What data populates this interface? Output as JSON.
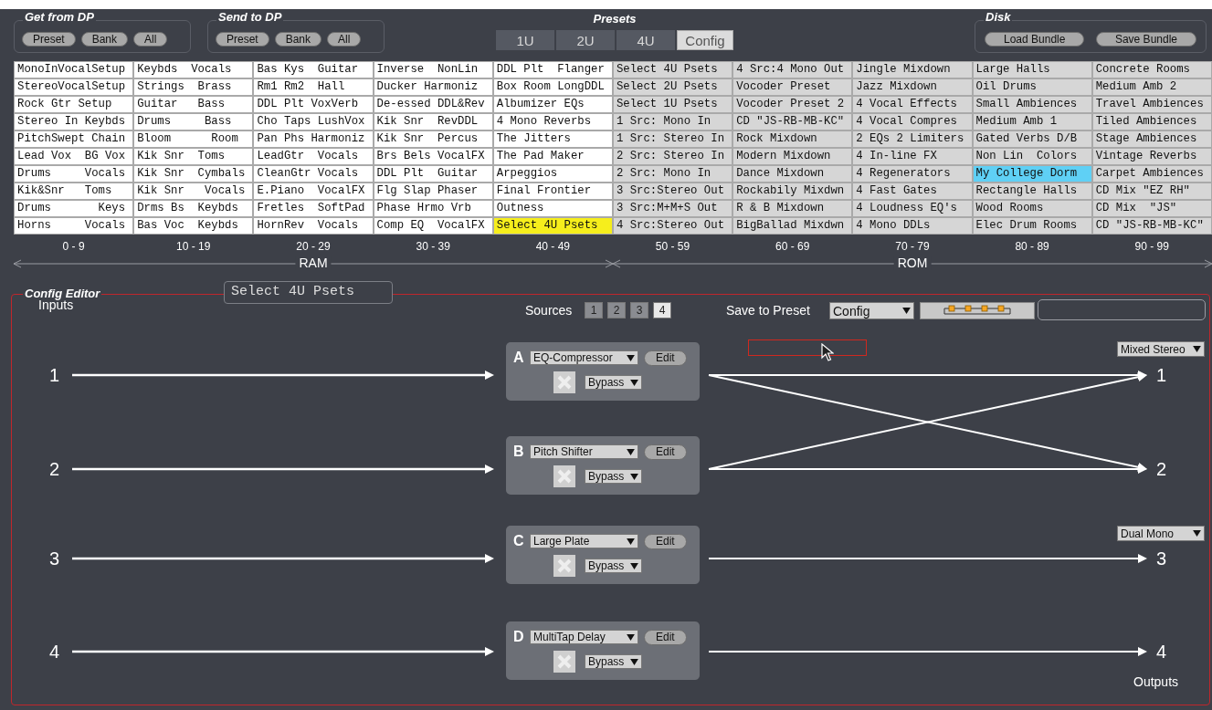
{
  "top_panel": {
    "get_from_dp": {
      "title": "Get from DP",
      "buttons": [
        "Preset",
        "Bank",
        "All"
      ]
    },
    "send_to_dp": {
      "title": "Send to DP",
      "buttons": [
        "Preset",
        "Bank",
        "All"
      ]
    },
    "presets": {
      "title": "Presets",
      "tabs": [
        {
          "label": "1U",
          "selected": false
        },
        {
          "label": "2U",
          "selected": false
        },
        {
          "label": "4U",
          "selected": false
        },
        {
          "label": "Config",
          "selected": true
        }
      ]
    },
    "disk": {
      "title": "Disk",
      "buttons": [
        "Load Bundle",
        "Save Bundle"
      ]
    }
  },
  "banks": [
    {
      "range": "0 - 9",
      "rom": false,
      "presets": [
        {
          "name": "MonoInVocalSetup",
          "selected": false,
          "drop_target": false
        },
        {
          "name": "StereoVocalSetup",
          "selected": false,
          "drop_target": false
        },
        {
          "name": "Rock Gtr Setup",
          "selected": false,
          "drop_target": false
        },
        {
          "name": "Stereo In Keybds",
          "selected": false,
          "drop_target": false
        },
        {
          "name": "PitchSwept Chain",
          "selected": false,
          "drop_target": false
        },
        {
          "name": "Lead Vox  BG Vox",
          "selected": false,
          "drop_target": false
        },
        {
          "name": "Drums     Vocals",
          "selected": false,
          "drop_target": false
        },
        {
          "name": "Kik&Snr   Toms",
          "selected": false,
          "drop_target": false
        },
        {
          "name": "Drums       Keys",
          "selected": false,
          "drop_target": false
        },
        {
          "name": "Horns     Vocals",
          "selected": false,
          "drop_target": false
        }
      ]
    },
    {
      "range": "10 - 19",
      "rom": false,
      "presets": [
        {
          "name": "Keybds  Vocals",
          "selected": false,
          "drop_target": false
        },
        {
          "name": "Strings  Brass",
          "selected": false,
          "drop_target": false
        },
        {
          "name": "Guitar   Bass",
          "selected": false,
          "drop_target": false
        },
        {
          "name": "Drums     Bass",
          "selected": false,
          "drop_target": false
        },
        {
          "name": "Bloom      Room",
          "selected": false,
          "drop_target": false
        },
        {
          "name": "Kik Snr  Toms",
          "selected": false,
          "drop_target": false
        },
        {
          "name": "Kik Snr  Cymbals",
          "selected": false,
          "drop_target": false
        },
        {
          "name": "Kik Snr   Vocals",
          "selected": false,
          "drop_target": false
        },
        {
          "name": "Drms Bs  Keybds",
          "selected": false,
          "drop_target": false
        },
        {
          "name": "Bas Voc  Keybds",
          "selected": false,
          "drop_target": false
        }
      ]
    },
    {
      "range": "20 - 29",
      "rom": false,
      "presets": [
        {
          "name": "Bas Kys  Guitar",
          "selected": false,
          "drop_target": false
        },
        {
          "name": "Rm1 Rm2  Hall",
          "selected": false,
          "drop_target": false
        },
        {
          "name": "DDL Plt VoxVerb",
          "selected": false,
          "drop_target": false
        },
        {
          "name": "Cho Taps LushVox",
          "selected": false,
          "drop_target": false
        },
        {
          "name": "Pan Phs Harmoniz",
          "selected": false,
          "drop_target": false
        },
        {
          "name": "LeadGtr  Vocals",
          "selected": false,
          "drop_target": false
        },
        {
          "name": "CleanGtr Vocals",
          "selected": false,
          "drop_target": false
        },
        {
          "name": "E.Piano  VocalFX",
          "selected": false,
          "drop_target": false
        },
        {
          "name": "Fretles  SoftPad",
          "selected": false,
          "drop_target": false
        },
        {
          "name": "HornRev  Vocals",
          "selected": false,
          "drop_target": false
        }
      ]
    },
    {
      "range": "30 - 39",
      "rom": false,
      "presets": [
        {
          "name": "Inverse  NonLin",
          "selected": false,
          "drop_target": false
        },
        {
          "name": "Ducker Harmoniz",
          "selected": false,
          "drop_target": false
        },
        {
          "name": "De-essed DDL&Rev",
          "selected": false,
          "drop_target": false
        },
        {
          "name": "Kik Snr  RevDDL",
          "selected": false,
          "drop_target": false
        },
        {
          "name": "Kik Snr  Percus",
          "selected": false,
          "drop_target": false
        },
        {
          "name": "Brs Bels VocalFX",
          "selected": false,
          "drop_target": false
        },
        {
          "name": "DDL Plt  Guitar",
          "selected": false,
          "drop_target": false
        },
        {
          "name": "Flg Slap Phaser",
          "selected": false,
          "drop_target": false
        },
        {
          "name": "Phase Hrmo Vrb",
          "selected": false,
          "drop_target": false
        },
        {
          "name": "Comp EQ  VocalFX",
          "selected": false,
          "drop_target": false
        }
      ]
    },
    {
      "range": "40 - 49",
      "rom": false,
      "presets": [
        {
          "name": "DDL Plt  Flanger",
          "selected": false,
          "drop_target": false
        },
        {
          "name": "Box Room LongDDL",
          "selected": false,
          "drop_target": false
        },
        {
          "name": "Albumizer EQs",
          "selected": false,
          "drop_target": false
        },
        {
          "name": "4 Mono Reverbs",
          "selected": false,
          "drop_target": false
        },
        {
          "name": "The Jitters",
          "selected": false,
          "drop_target": false
        },
        {
          "name": "The Pad Maker",
          "selected": false,
          "drop_target": false
        },
        {
          "name": "Arpeggios",
          "selected": false,
          "drop_target": false
        },
        {
          "name": "Final Frontier",
          "selected": false,
          "drop_target": false
        },
        {
          "name": "Outness",
          "selected": false,
          "drop_target": false
        },
        {
          "name": "Select 4U Psets",
          "selected": true,
          "drop_target": false
        }
      ]
    },
    {
      "range": "50 - 59",
      "rom": true,
      "presets": [
        {
          "name": "Select 4U Psets",
          "selected": false,
          "drop_target": false
        },
        {
          "name": "Select 2U Psets",
          "selected": false,
          "drop_target": false
        },
        {
          "name": "Select 1U Psets",
          "selected": false,
          "drop_target": false
        },
        {
          "name": "1 Src: Mono In",
          "selected": false,
          "drop_target": false
        },
        {
          "name": "1 Src: Stereo In",
          "selected": false,
          "drop_target": false
        },
        {
          "name": "2 Src: Stereo In",
          "selected": false,
          "drop_target": false
        },
        {
          "name": "2 Src: Mono In",
          "selected": false,
          "drop_target": false
        },
        {
          "name": "3 Src:Stereo Out",
          "selected": false,
          "drop_target": false
        },
        {
          "name": "3 Src:M+M+S Out",
          "selected": false,
          "drop_target": false
        },
        {
          "name": "4 Src:Stereo Out",
          "selected": false,
          "drop_target": false
        }
      ]
    },
    {
      "range": "60 - 69",
      "rom": true,
      "presets": [
        {
          "name": "4 Src:4 Mono Out",
          "selected": false,
          "drop_target": false
        },
        {
          "name": "Vocoder Preset",
          "selected": false,
          "drop_target": false
        },
        {
          "name": "Vocoder Preset 2",
          "selected": false,
          "drop_target": false
        },
        {
          "name": "CD \"JS-RB-MB-KC\"",
          "selected": false,
          "drop_target": false
        },
        {
          "name": "Rock Mixdown",
          "selected": false,
          "drop_target": false
        },
        {
          "name": "Modern Mixdown",
          "selected": false,
          "drop_target": false
        },
        {
          "name": "Dance Mixdown",
          "selected": false,
          "drop_target": false
        },
        {
          "name": "Rockabily Mixdwn",
          "selected": false,
          "drop_target": false
        },
        {
          "name": "R & B Mixdown",
          "selected": false,
          "drop_target": false
        },
        {
          "name": "BigBallad Mixdwn",
          "selected": false,
          "drop_target": false
        }
      ]
    },
    {
      "range": "70 - 79",
      "rom": true,
      "presets": [
        {
          "name": "Jingle Mixdown",
          "selected": false,
          "drop_target": false
        },
        {
          "name": "Jazz Mixdown",
          "selected": false,
          "drop_target": false
        },
        {
          "name": "4 Vocal Effects",
          "selected": false,
          "drop_target": false
        },
        {
          "name": "4 Vocal Compres",
          "selected": false,
          "drop_target": false
        },
        {
          "name": "2 EQs 2 Limiters",
          "selected": false,
          "drop_target": false
        },
        {
          "name": "4 In-line FX",
          "selected": false,
          "drop_target": false
        },
        {
          "name": "4 Regenerators",
          "selected": false,
          "drop_target": false
        },
        {
          "name": "4 Fast Gates",
          "selected": false,
          "drop_target": false
        },
        {
          "name": "4 Loudness EQ's",
          "selected": false,
          "drop_target": false
        },
        {
          "name": "4 Mono DDLs",
          "selected": false,
          "drop_target": false
        }
      ]
    },
    {
      "range": "80 - 89",
      "rom": true,
      "presets": [
        {
          "name": "Large Halls",
          "selected": false,
          "drop_target": false
        },
        {
          "name": "Oil Drums",
          "selected": false,
          "drop_target": false
        },
        {
          "name": "Small Ambiences",
          "selected": false,
          "drop_target": false
        },
        {
          "name": "Medium Amb 1",
          "selected": false,
          "drop_target": false
        },
        {
          "name": "Gated Verbs D/B",
          "selected": false,
          "drop_target": false
        },
        {
          "name": "Non Lin  Colors",
          "selected": false,
          "drop_target": false
        },
        {
          "name": "My College Dorm",
          "selected": false,
          "drop_target": true
        },
        {
          "name": "Rectangle Halls",
          "selected": false,
          "drop_target": false
        },
        {
          "name": "Wood Rooms",
          "selected": false,
          "drop_target": false
        },
        {
          "name": "Elec Drum Rooms",
          "selected": false,
          "drop_target": false
        }
      ]
    },
    {
      "range": "90 - 99",
      "rom": true,
      "presets": [
        {
          "name": "Concrete Rooms",
          "selected": false,
          "drop_target": false
        },
        {
          "name": "Medium Amb 2",
          "selected": false,
          "drop_target": false
        },
        {
          "name": "Travel Ambiences",
          "selected": false,
          "drop_target": false
        },
        {
          "name": "Tiled Ambiences",
          "selected": false,
          "drop_target": false
        },
        {
          "name": "Stage Ambiences",
          "selected": false,
          "drop_target": false
        },
        {
          "name": "Vintage Reverbs",
          "selected": false,
          "drop_target": false
        },
        {
          "name": "Carpet Ambiences",
          "selected": false,
          "drop_target": false
        },
        {
          "name": "CD Mix \"EZ RH\"",
          "selected": false,
          "drop_target": false
        },
        {
          "name": "CD Mix  \"JS\"",
          "selected": false,
          "drop_target": false
        },
        {
          "name": "CD \"JS-RB-MB-KC\"",
          "selected": false,
          "drop_target": false
        }
      ]
    }
  ],
  "memory_spans": [
    {
      "label": "RAM"
    },
    {
      "label": "ROM"
    }
  ],
  "config_editor": {
    "title": "Config Editor",
    "name": "Select 4U Psets",
    "inputs_label": "Inputs",
    "outputs_label": "Outputs",
    "sources_label": "Sources",
    "sources": [
      {
        "label": "1",
        "selected": false
      },
      {
        "label": "2",
        "selected": false
      },
      {
        "label": "3",
        "selected": false
      },
      {
        "label": "4",
        "selected": true
      }
    ],
    "save_label": "Save to Preset",
    "save_target": "Config",
    "dragging": true,
    "inputs": [
      "1",
      "2",
      "3",
      "4"
    ],
    "processors": [
      {
        "letter": "A",
        "effect": "EQ-Compressor",
        "edit": "Edit",
        "bypass": "Bypass",
        "sends": [
          true,
          true,
          false,
          false
        ]
      },
      {
        "letter": "B",
        "effect": "Pitch Shifter",
        "edit": "Edit",
        "bypass": "Bypass",
        "sends": [
          true,
          true,
          false,
          false
        ]
      },
      {
        "letter": "C",
        "effect": "Large Plate",
        "edit": "Edit",
        "bypass": "Bypass",
        "sends": [
          false,
          false,
          true,
          false
        ]
      },
      {
        "letter": "D",
        "effect": "MultiTap Delay",
        "edit": "Edit",
        "bypass": "Bypass",
        "sends": [
          false,
          false,
          false,
          true
        ]
      }
    ],
    "output_pairs": [
      {
        "mode": "Mixed Stereo"
      },
      {
        "mode": "Dual Mono"
      }
    ],
    "outputs": [
      "1",
      "2",
      "3",
      "4"
    ]
  }
}
